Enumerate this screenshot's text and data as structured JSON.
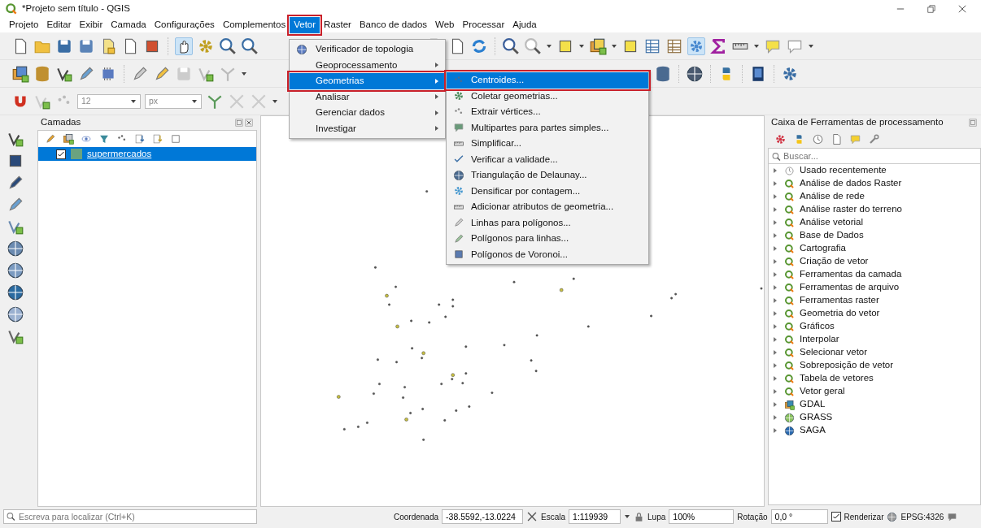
{
  "window": {
    "title": "*Projeto sem título - QGIS"
  },
  "menus": [
    {
      "label": "Projeto",
      "selected": false,
      "annotated": false
    },
    {
      "label": "Editar",
      "selected": false,
      "annotated": false
    },
    {
      "label": "Exibir",
      "selected": false,
      "annotated": false
    },
    {
      "label": "Camada",
      "selected": false,
      "annotated": false
    },
    {
      "label": "Configurações",
      "selected": false,
      "annotated": false
    },
    {
      "label": "Complementos",
      "selected": false,
      "annotated": false
    },
    {
      "label": "Vetor",
      "selected": true,
      "annotated": true
    },
    {
      "label": "Raster",
      "selected": false,
      "annotated": false
    },
    {
      "label": "Banco de dados",
      "selected": false,
      "annotated": false
    },
    {
      "label": "Web",
      "selected": false,
      "annotated": false
    },
    {
      "label": "Processar",
      "selected": false,
      "annotated": false
    },
    {
      "label": "Ajuda",
      "selected": false,
      "annotated": false
    }
  ],
  "vetor_menu": [
    {
      "label": "Verificador de topologia",
      "submenu": false,
      "selected": false,
      "annotated": false
    },
    {
      "label": "Geoprocessamento",
      "submenu": true,
      "selected": false,
      "annotated": false
    },
    {
      "label": "Geometrias",
      "submenu": true,
      "selected": true,
      "annotated": true
    },
    {
      "label": "Analisar",
      "submenu": true,
      "selected": false,
      "annotated": false
    },
    {
      "label": "Gerenciar dados",
      "submenu": true,
      "selected": false,
      "annotated": false
    },
    {
      "label": "Investigar",
      "submenu": true,
      "selected": false,
      "annotated": false
    }
  ],
  "geometrias_submenu": [
    {
      "label": "Centroides...",
      "selected": true,
      "annotated": true
    },
    {
      "label": "Coletar geometrias...",
      "selected": false,
      "annotated": false
    },
    {
      "label": "Extrair vértices...",
      "selected": false,
      "annotated": false
    },
    {
      "label": "Multipartes para partes simples...",
      "selected": false,
      "annotated": false
    },
    {
      "label": "Simplificar...",
      "selected": false,
      "annotated": false
    },
    {
      "label": "Verificar a validade...",
      "selected": false,
      "annotated": false
    },
    {
      "label": "Triangulação de Delaunay...",
      "selected": false,
      "annotated": false
    },
    {
      "label": "Densificar por contagem...",
      "selected": false,
      "annotated": false
    },
    {
      "label": "Adicionar atributos de geometria...",
      "selected": false,
      "annotated": false
    },
    {
      "label": "Linhas para polígonos...",
      "selected": false,
      "annotated": false
    },
    {
      "label": "Polígonos para linhas...",
      "selected": false,
      "annotated": false
    },
    {
      "label": "Polígonos de Voronoi...",
      "selected": false,
      "annotated": false
    }
  ],
  "snapping": {
    "tolerance": "12",
    "unit": "px"
  },
  "layers_panel": {
    "title": "Camadas",
    "layers": [
      {
        "name": "supermercados",
        "checked": true,
        "selected": true,
        "color": "#6aa37f"
      }
    ]
  },
  "processing_panel": {
    "title": "Caixa de Ferramentas de processamento",
    "search_placeholder": "Buscar...",
    "groups": [
      {
        "label": "Usado recentemente",
        "kind": "recent"
      },
      {
        "label": "Análise de dados Raster",
        "kind": "qgis"
      },
      {
        "label": "Análise de rede",
        "kind": "qgis"
      },
      {
        "label": "Análise raster do terreno",
        "kind": "qgis"
      },
      {
        "label": "Análise vetorial",
        "kind": "qgis"
      },
      {
        "label": "Base de Dados",
        "kind": "qgis"
      },
      {
        "label": "Cartografia",
        "kind": "qgis"
      },
      {
        "label": "Criação de vetor",
        "kind": "qgis"
      },
      {
        "label": "Ferramentas da camada",
        "kind": "qgis"
      },
      {
        "label": "Ferramentas de arquivo",
        "kind": "qgis"
      },
      {
        "label": "Ferramentas raster",
        "kind": "qgis"
      },
      {
        "label": "Geometria do vetor",
        "kind": "qgis"
      },
      {
        "label": "Gráficos",
        "kind": "qgis"
      },
      {
        "label": "Interpolar",
        "kind": "qgis"
      },
      {
        "label": "Selecionar vetor",
        "kind": "qgis"
      },
      {
        "label": "Sobreposição de vetor",
        "kind": "qgis"
      },
      {
        "label": "Tabela de vetores",
        "kind": "qgis"
      },
      {
        "label": "Vetor geral",
        "kind": "qgis"
      },
      {
        "label": "GDAL",
        "kind": "gdal"
      },
      {
        "label": "GRASS",
        "kind": "grass"
      },
      {
        "label": "SAGA",
        "kind": "saga"
      }
    ]
  },
  "status_bar": {
    "locate_placeholder": "Escreva para localizar (Ctrl+K)",
    "coordinate_label": "Coordenada",
    "coordinate": "-38.5592,-13.0224",
    "scale_label": "Escala",
    "scale": "1:119939",
    "magnifier_label": "Lupa",
    "magnifier": "100%",
    "rotation_label": "Rotação",
    "rotation": "0,0 °",
    "render_label": "Renderizar",
    "render": true,
    "crs": "EPSG:4326"
  }
}
